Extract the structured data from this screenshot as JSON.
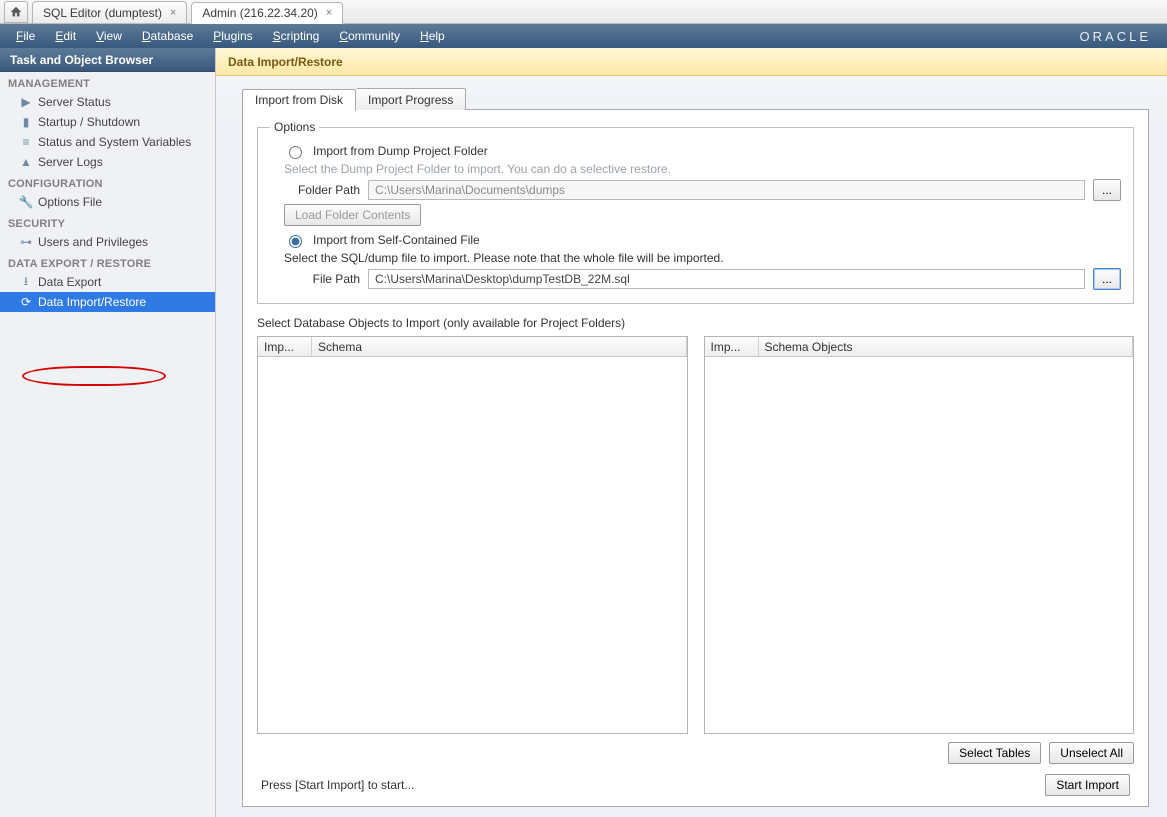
{
  "tabs": [
    {
      "label": "SQL Editor (dumptest)",
      "active": false
    },
    {
      "label": "Admin (216.22.34.20)",
      "active": true
    }
  ],
  "menubar": [
    "File",
    "Edit",
    "View",
    "Database",
    "Plugins",
    "Scripting",
    "Community",
    "Help"
  ],
  "brand": "ORACLE",
  "sidebar": {
    "title": "Task and Object Browser",
    "sections": [
      {
        "title": "MANAGEMENT",
        "items": [
          {
            "label": "Server Status",
            "icon": "play-icon"
          },
          {
            "label": "Startup / Shutdown",
            "icon": "server-icon"
          },
          {
            "label": "Status and System Variables",
            "icon": "list-icon"
          },
          {
            "label": "Server Logs",
            "icon": "alert-icon"
          }
        ]
      },
      {
        "title": "CONFIGURATION",
        "items": [
          {
            "label": "Options File",
            "icon": "wrench-icon"
          }
        ]
      },
      {
        "title": "SECURITY",
        "items": [
          {
            "label": "Users and Privileges",
            "icon": "key-icon"
          }
        ]
      },
      {
        "title": "DATA EXPORT / RESTORE",
        "items": [
          {
            "label": "Data Export",
            "icon": "download-icon",
            "selected": false
          },
          {
            "label": "Data Import/Restore",
            "icon": "refresh-icon",
            "selected": true
          }
        ]
      }
    ]
  },
  "page": {
    "title": "Data Import/Restore",
    "inner_tabs": [
      "Import from Disk",
      "Import Progress"
    ],
    "active_tab": 0,
    "options_legend": "Options",
    "radio_folder_label": "Import from Dump Project Folder",
    "folder_hint": "Select the Dump Project Folder to import. You can do a selective restore.",
    "folder_path_label": "Folder Path",
    "folder_path_value": "C:\\Users\\Marina\\Documents\\dumps",
    "load_folder_btn": "Load Folder Contents",
    "radio_file_label": "Import from Self-Contained File",
    "file_hint": "Select the SQL/dump file to import. Please note that the whole file will be imported.",
    "file_path_label": "File Path",
    "file_path_value": "C:\\Users\\Marina\\Desktop\\dumpTestDB_22M.sql",
    "section2_title": "Select Database Objects to Import (only available for Project Folders)",
    "left_cols": [
      "Imp...",
      "Schema"
    ],
    "right_cols": [
      "Imp...",
      "Schema Objects"
    ],
    "select_tables_btn": "Select Tables",
    "unselect_all_btn": "Unselect All",
    "status_text": "Press [Start Import] to start...",
    "start_import_btn": "Start Import",
    "browse_label": "..."
  }
}
